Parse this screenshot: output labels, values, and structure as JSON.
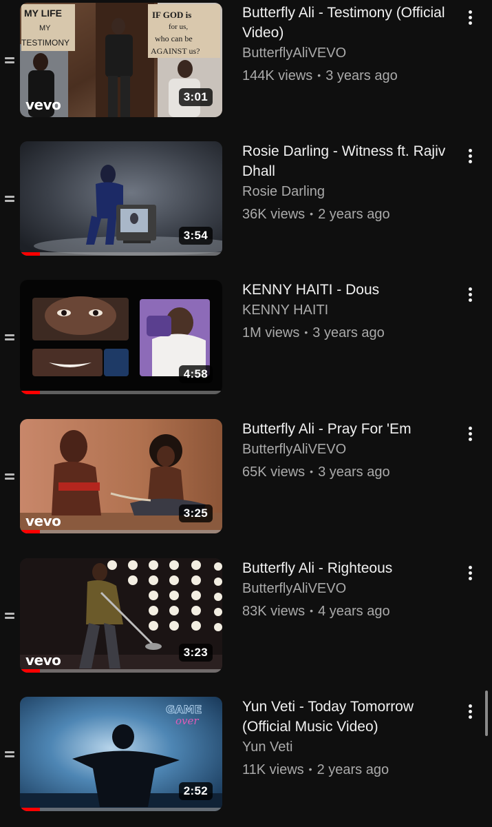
{
  "videos": [
    {
      "title": "Butterfly Ali - Testimony (Official Video)",
      "channel": "ButterflyAliVEVO",
      "views": "144K views",
      "age": "3 years ago",
      "duration": "3:01",
      "badge": "vevo",
      "watch_progress": 0
    },
    {
      "title": "Rosie Darling - Witness ft. Rajiv Dhall",
      "channel": "Rosie Darling",
      "views": "36K views",
      "age": "2 years ago",
      "duration": "3:54",
      "badge": "",
      "watch_progress": 0.1
    },
    {
      "title": "KENNY HAITI - Dous",
      "channel": "KENNY HAITI",
      "views": "1M views",
      "age": "3 years ago",
      "duration": "4:58",
      "badge": "",
      "watch_progress": 0.1
    },
    {
      "title": "Butterfly Ali - Pray For 'Em",
      "channel": "ButterflyAliVEVO",
      "views": "65K views",
      "age": "3 years ago",
      "duration": "3:25",
      "badge": "vevo",
      "watch_progress": 0.1
    },
    {
      "title": "Butterfly Ali - Righteous",
      "channel": "ButterflyAliVEVO",
      "views": "83K views",
      "age": "4 years ago",
      "duration": "3:23",
      "badge": "vevo",
      "watch_progress": 0.1
    },
    {
      "title": "Yun Veti - Today Tomorrow (Official Music Video)",
      "channel": "Yun Veti",
      "views": "11K views",
      "age": "2 years ago",
      "duration": "2:52",
      "badge": "",
      "watch_progress": 0.1
    }
  ],
  "thumbnail_text": {
    "sign_left": [
      "MY LIFE",
      "MY",
      "TESTIMONY"
    ],
    "sign_right": [
      "IF GOD is",
      "for us,",
      "who can be",
      "AGAINST us?"
    ],
    "game_over": [
      "GAME",
      "over"
    ]
  },
  "colors": {
    "background": "#0f0f0f",
    "text_primary": "#f1f1f1",
    "text_secondary": "#aaaaaa",
    "progress": "#ff0000"
  },
  "icons": {
    "drag": "drag-handle-icon",
    "more": "more-vertical-icon"
  }
}
